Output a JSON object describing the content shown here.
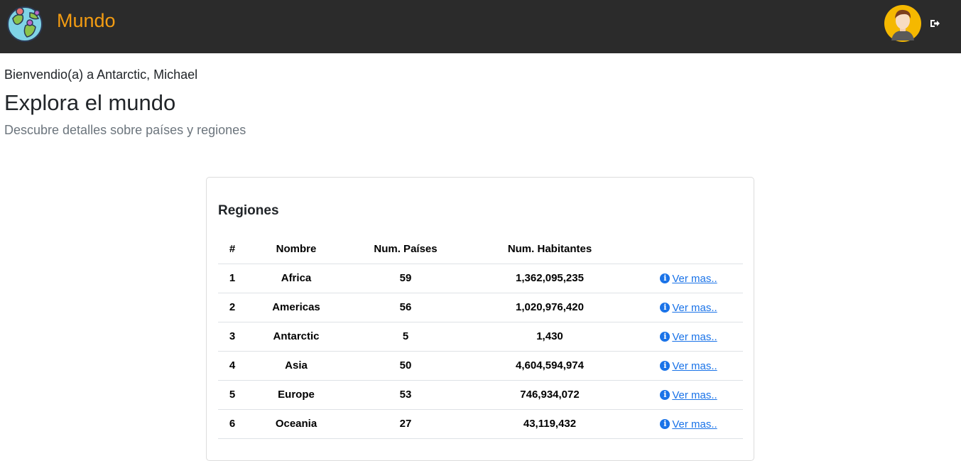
{
  "header": {
    "brand_name": "Mundo",
    "brand_logo": "globe-icon",
    "avatar": "user-avatar",
    "logout_icon": "logout-icon",
    "accent_color": "#f39c12",
    "bg_color": "#2b2b2b"
  },
  "main": {
    "welcome": "Bienvendio(a) a Antarctic, Michael",
    "title": "Explora el mundo",
    "subtitle": "Descubre detalles sobre países y regiones"
  },
  "regions": {
    "title": "Regiones",
    "columns": [
      "#",
      "Nombre",
      "Num. Países",
      "Num. Habitantes",
      ""
    ],
    "link_label": " Ver mas..",
    "rows": [
      {
        "idx": "1",
        "name": "Africa",
        "countries": "59",
        "population": "1,362,095,235"
      },
      {
        "idx": "2",
        "name": "Americas",
        "countries": "56",
        "population": "1,020,976,420"
      },
      {
        "idx": "3",
        "name": "Antarctic",
        "countries": "5",
        "population": "1,430"
      },
      {
        "idx": "4",
        "name": "Asia",
        "countries": "50",
        "population": "4,604,594,974"
      },
      {
        "idx": "5",
        "name": "Europe",
        "countries": "53",
        "population": "746,934,072"
      },
      {
        "idx": "6",
        "name": "Oceania",
        "countries": "27",
        "population": "43,119,432"
      }
    ]
  }
}
